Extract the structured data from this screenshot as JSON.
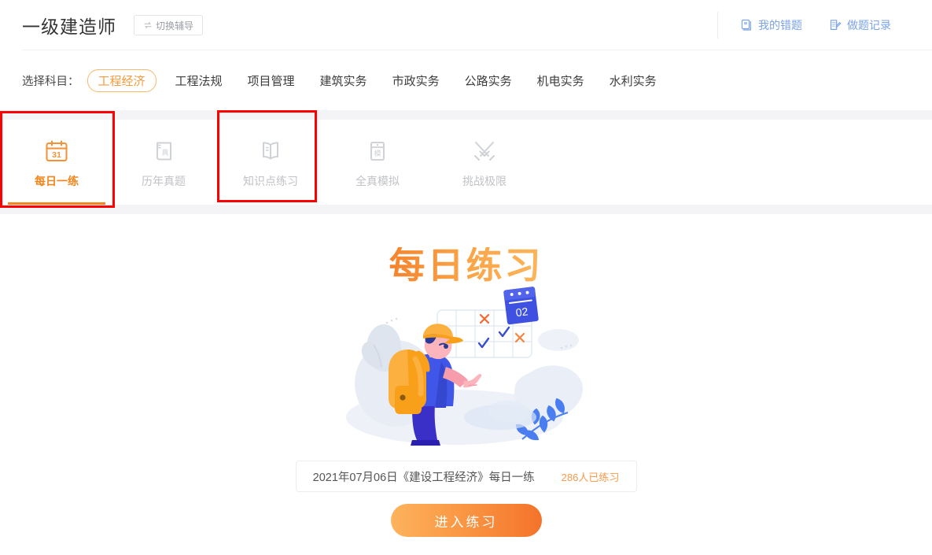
{
  "header": {
    "title": "一级建造师",
    "switch_button": {
      "label": "切换辅导",
      "icon": "swap-icon"
    },
    "links": [
      {
        "label": "我的错题",
        "icon": "book-icon"
      },
      {
        "label": "做题记录",
        "icon": "note-pencil-icon"
      }
    ]
  },
  "subjects": {
    "label": "选择科目：",
    "items": [
      {
        "label": "工程经济",
        "active": true
      },
      {
        "label": "工程法规",
        "active": false
      },
      {
        "label": "项目管理",
        "active": false
      },
      {
        "label": "建筑实务",
        "active": false
      },
      {
        "label": "市政实务",
        "active": false
      },
      {
        "label": "公路实务",
        "active": false
      },
      {
        "label": "机电实务",
        "active": false
      },
      {
        "label": "水利实务",
        "active": false
      }
    ]
  },
  "tabs": [
    {
      "label": "每日一练",
      "icon": "calendar-31-icon",
      "active": true,
      "highlighted": true
    },
    {
      "label": "历年真题",
      "icon": "book-zhen-icon",
      "active": false,
      "highlighted": false
    },
    {
      "label": "知识点练习",
      "icon": "open-book-icon",
      "active": false,
      "highlighted": true
    },
    {
      "label": "全真模拟",
      "icon": "paper-mo-icon",
      "active": false,
      "highlighted": false
    },
    {
      "label": "挑战极限",
      "icon": "crossed-swords-icon",
      "active": false,
      "highlighted": false
    }
  ],
  "main": {
    "banner_title": "每日练习",
    "illustration": {
      "name": "student-checking-calendar-illustration",
      "calendar_day": "02",
      "marks": [
        "✗",
        "✓",
        "✓",
        "✗"
      ]
    },
    "info": {
      "text": "2021年07月06日《建设工程经济》每日一练",
      "count": "286人已练习"
    },
    "cta_label": "进入练习"
  },
  "colors": {
    "accent_orange": "#f0861e",
    "link_blue": "#7ba3e8",
    "annotation_red": "#ff0000",
    "muted_gray": "#c0c2c6",
    "band_gray": "#f4f4f6"
  }
}
